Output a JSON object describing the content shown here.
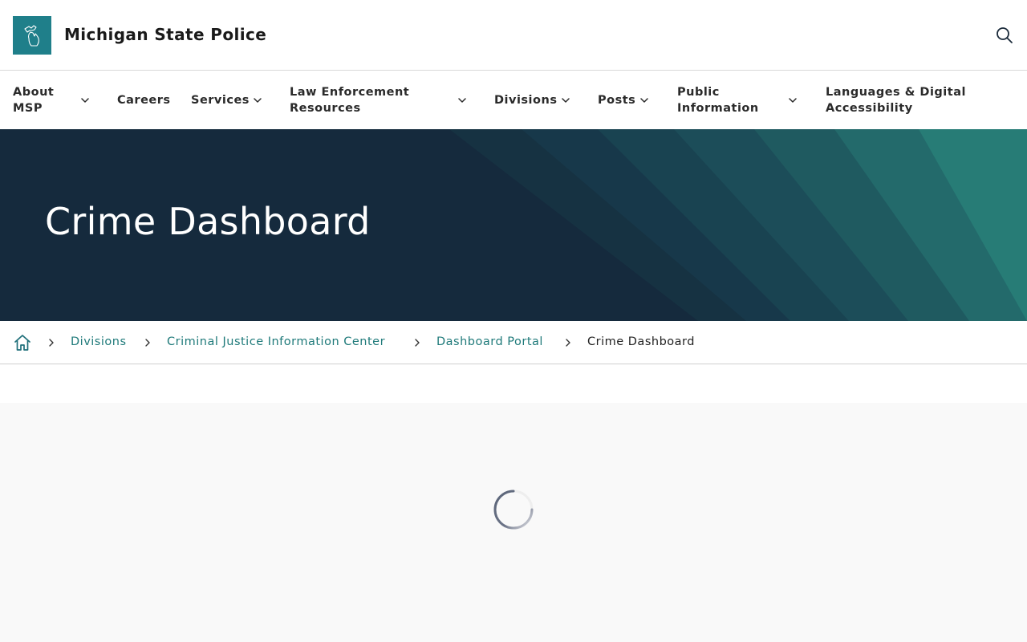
{
  "header": {
    "site_title": "Michigan State Police",
    "logo_icon": "michigan-state-outline-icon",
    "search_icon": "search-icon"
  },
  "nav": {
    "items": [
      {
        "label": "About MSP",
        "has_dropdown": true
      },
      {
        "label": "Careers",
        "has_dropdown": false
      },
      {
        "label": "Services",
        "has_dropdown": true
      },
      {
        "label": "Law Enforcement Resources",
        "has_dropdown": true
      },
      {
        "label": "Divisions",
        "has_dropdown": true
      },
      {
        "label": "Posts",
        "has_dropdown": true
      },
      {
        "label": "Public Information",
        "has_dropdown": true
      },
      {
        "label": "Languages & Digital Accessibility",
        "has_dropdown": false
      }
    ]
  },
  "hero": {
    "title": "Crime Dashboard"
  },
  "breadcrumb": {
    "home_icon": "home-icon",
    "links": [
      "Divisions",
      "Criminal Justice Information Center",
      "Dashboard Portal"
    ],
    "current": "Crime Dashboard"
  },
  "content": {
    "state": "loading",
    "spinner_icon": "loading-spinner-icon"
  },
  "colors": {
    "brand_teal": "#1f7f8a",
    "link": "#1f7a7a",
    "hero_bg": "#152a3d",
    "content_bg": "#f9f9f9"
  }
}
